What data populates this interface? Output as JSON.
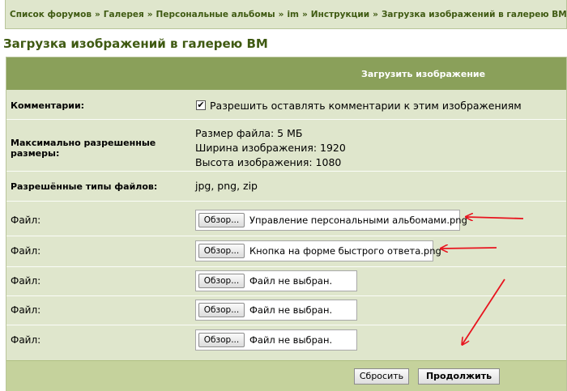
{
  "breadcrumb": [
    {
      "label": "Список форумов"
    },
    {
      "label": "Галерея"
    },
    {
      "label": "Персональные альбомы"
    },
    {
      "label": "im"
    },
    {
      "label": "Инструкции"
    },
    {
      "label": "Загрузка изображений в галерею ВМ"
    }
  ],
  "breadcrumb_separator": "»",
  "page_title": "Загрузка изображений в галерею ВМ",
  "table_header": "Загрузить изображение",
  "comments": {
    "label": "Комментарии:",
    "checkbox_checked": true,
    "checkbox_mark": "✔",
    "checkbox_label": "Разрешить оставлять комментарии к этим изображениям"
  },
  "limits": {
    "label": "Максимально разрешенные размеры:",
    "file_size": "Размер файла:  5 МБ",
    "width": "Ширина изображения:  1920",
    "height": "Высота изображения:  1080"
  },
  "types": {
    "label": "Разрешённые типы файлов:",
    "value": "jpg, png, zip"
  },
  "files": [
    {
      "label": "Файл:",
      "button": "Обзор...",
      "filename": "Управление персональными альбомами.png"
    },
    {
      "label": "Файл:",
      "button": "Обзор...",
      "filename": "Кнопка на форме быстрого ответа.png"
    },
    {
      "label": "Файл:",
      "button": "Обзор...",
      "filename": "Файл не выбран."
    },
    {
      "label": "Файл:",
      "button": "Обзор...",
      "filename": "Файл не выбран."
    },
    {
      "label": "Файл:",
      "button": "Обзор...",
      "filename": "Файл не выбран."
    }
  ],
  "buttons": {
    "reset": "Сбросить",
    "continue": "Продолжить"
  },
  "colors": {
    "breadcrumb_text": "#3f5a12",
    "header_bg": "#8aa05a",
    "panel_bg": "#dfe6cc",
    "footer_bg": "#c5d29c",
    "annotation_arrow": "#e8141e"
  }
}
